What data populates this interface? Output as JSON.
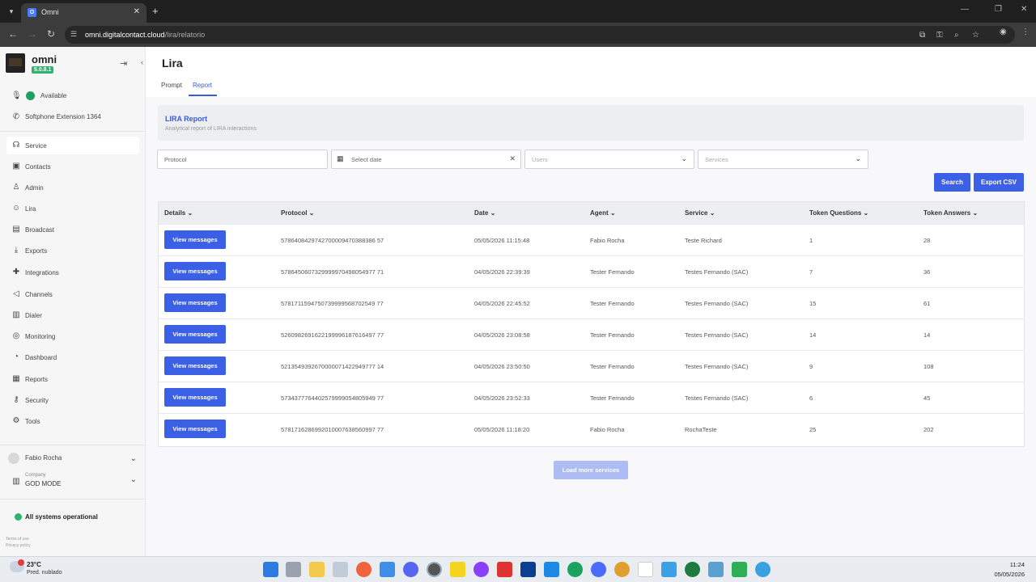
{
  "browser": {
    "tab_title": "Omni",
    "url_host": "omni.digitalcontact.cloud",
    "url_path": "/lira/relatorio"
  },
  "sidebar": {
    "app_name": "omni",
    "version": "5.0.8.1",
    "status": "Available",
    "softphone": "Softphone Extension 1364",
    "items": [
      {
        "label": "Service",
        "icon": "headset-icon"
      },
      {
        "label": "Contacts",
        "icon": "contacts-icon"
      },
      {
        "label": "Admin",
        "icon": "admin-icon"
      },
      {
        "label": "Lira",
        "icon": "robot-icon"
      },
      {
        "label": "Broadcast",
        "icon": "broadcast-icon"
      },
      {
        "label": "Exports",
        "icon": "download-icon"
      },
      {
        "label": "Integrations",
        "icon": "puzzle-icon"
      },
      {
        "label": "Channels",
        "icon": "megaphone-icon"
      },
      {
        "label": "Dialer",
        "icon": "dialer-icon"
      },
      {
        "label": "Monitoring",
        "icon": "monitoring-icon"
      },
      {
        "label": "Dashboard",
        "icon": "dashboard-icon"
      },
      {
        "label": "Reports",
        "icon": "reports-icon"
      },
      {
        "label": "Security",
        "icon": "key-icon"
      },
      {
        "label": "Tools",
        "icon": "gear-icon"
      }
    ],
    "user_name": "Fabio Rocha",
    "company_label": "Company",
    "company_name": "GOD MODE",
    "system_status": "All systems operational",
    "terms": "Terms of use",
    "privacy": "Privacy policy"
  },
  "page": {
    "title": "Lira",
    "tabs": [
      "Prompt",
      "Report"
    ],
    "active_tab": "Report",
    "report_title": "LIRA Report",
    "report_subtitle": "Analytical report of LIRA interactions"
  },
  "filters": {
    "protocol_placeholder": "Protocol",
    "date_placeholder": "Select date",
    "users_placeholder": "Users",
    "services_placeholder": "Services",
    "search_label": "Search",
    "export_label": "Export CSV"
  },
  "table": {
    "columns": [
      "Details",
      "Protocol",
      "Date",
      "Agent",
      "Service",
      "Token Questions",
      "Token Answers"
    ],
    "view_label": "View messages",
    "rows": [
      {
        "protocol": "5786408429742700009470388386 57",
        "date": "05/05/2026 11:15:48",
        "agent": "Fabio Rocha",
        "service": "Teste Richard",
        "tq": "1",
        "ta": "28"
      },
      {
        "protocol": "5786450607329999970498054977 71",
        "date": "04/05/2026 22:39:39",
        "agent": "Tester Fernando",
        "service": "Testes Fernando (SAC)",
        "tq": "7",
        "ta": "36"
      },
      {
        "protocol": "5781711594750739999568702549 77",
        "date": "04/05/2026 22:45:52",
        "agent": "Tester Fernando",
        "service": "Testes Fernando (SAC)",
        "tq": "15",
        "ta": "61"
      },
      {
        "protocol": "5260982691622199996187616497 77",
        "date": "04/05/2026 23:08:58",
        "agent": "Tester Fernando",
        "service": "Testes Fernando (SAC)",
        "tq": "14",
        "ta": "14"
      },
      {
        "protocol": "5213549392670000071422949777 14",
        "date": "04/05/2026 23:50:50",
        "agent": "Tester Fernando",
        "service": "Testes Fernando (SAC)",
        "tq": "9",
        "ta": "108"
      },
      {
        "protocol": "5734377764402579999054805949 77",
        "date": "04/05/2026 23:52:33",
        "agent": "Tester Fernando",
        "service": "Testes Fernando (SAC)",
        "tq": "6",
        "ta": "45"
      },
      {
        "protocol": "5781716286992010007638560997 77",
        "date": "05/05/2026 11:18:20",
        "agent": "Fabio Rocha",
        "service": "RochaTeste",
        "tq": "25",
        "ta": "202"
      }
    ]
  },
  "load_more": "Load more services",
  "taskbar": {
    "temperature": "23°C",
    "forecast": "Pred. nublado",
    "time": "11:24",
    "date": "05/05/2026"
  }
}
